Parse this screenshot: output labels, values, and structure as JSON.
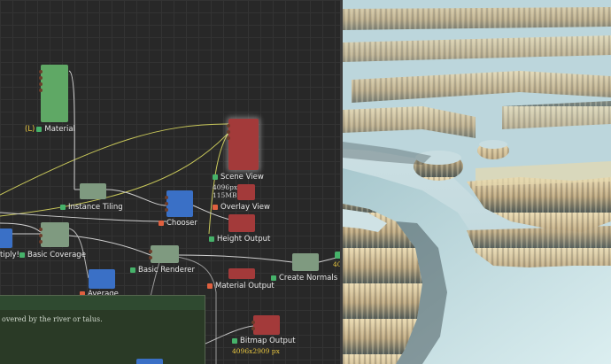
{
  "graph": {
    "nodes": {
      "material": {
        "label": "Material",
        "prefix": "(L)"
      },
      "instance_tiling": {
        "label": "Instance Tiling"
      },
      "chooser": {
        "label": "Chooser"
      },
      "scene_view": {
        "label": "Scene View",
        "size": "4096px",
        "memory": "115MB",
        "time": "1ms"
      },
      "overlay_view": {
        "label": "Overlay View"
      },
      "height_output": {
        "label": "Height Output"
      },
      "multiply": {
        "label": "tiply!"
      },
      "basic_coverage": {
        "label": "Basic Coverage"
      },
      "basic_renderer": {
        "label": "Basic Renderer"
      },
      "create_normals": {
        "label": "Create Normals"
      },
      "average": {
        "label": "Average"
      },
      "material_output": {
        "label": "Material Output"
      },
      "bitmap_output": {
        "label": "Bitmap Output",
        "resolution": "4096x2909 px"
      }
    },
    "frame": {
      "text": "overed by the river or talus."
    },
    "edge_marker": "40"
  },
  "colors": {
    "node_green": "#5fa865",
    "node_sage": "#7f9a80",
    "node_blue": "#3a70c6",
    "node_red": "#a33a3a",
    "wire_yellow": "#c9c85a",
    "wire_white": "#d0d0d0",
    "status_green": "#46b26a",
    "status_red": "#e0603f"
  }
}
